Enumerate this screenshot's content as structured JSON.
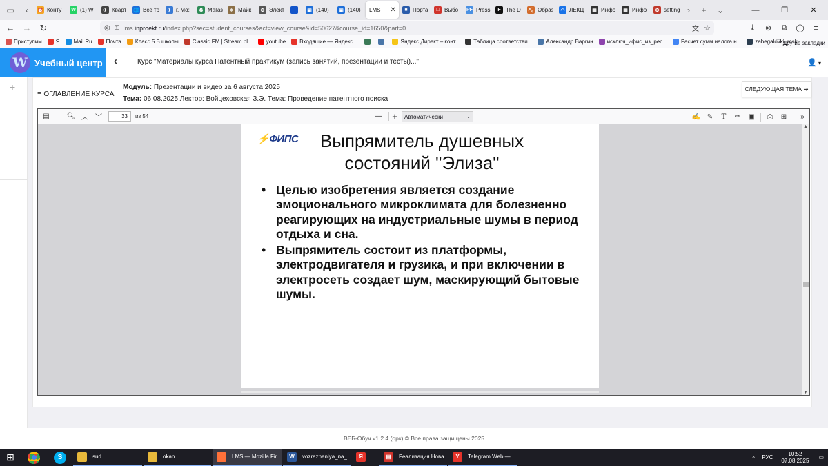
{
  "browser": {
    "tabs": [
      {
        "label": "Конту",
        "color": "#f5a623",
        "glyph": "⏰"
      },
      {
        "label": "(1) W",
        "color": "#25d366",
        "glyph": "W"
      },
      {
        "label": "Кварт",
        "color": "#444",
        "glyph": "✈"
      },
      {
        "label": "Все то",
        "color": "#1e6fd9",
        "glyph": "🌐"
      },
      {
        "label": "г. Мо:",
        "color": "#3a7bd5",
        "glyph": "✈"
      },
      {
        "label": "Магаз",
        "color": "#2e8b57",
        "glyph": "♻"
      },
      {
        "label": "Майк",
        "color": "#8b6f47",
        "glyph": "✳"
      },
      {
        "label": "Элект",
        "color": "#555",
        "glyph": "⚙"
      },
      {
        "label": "",
        "color": "#1355c9",
        "glyph": ""
      },
      {
        "label": "(140)",
        "color": "#1e6fd9",
        "glyph": "▣"
      },
      {
        "label": "(140)",
        "color": "#1e6fd9",
        "glyph": "▣"
      },
      {
        "label": "LMS",
        "color": "",
        "glyph": "",
        "active": true
      },
      {
        "label": "Порта",
        "color": "#2a5caa",
        "glyph": "■"
      },
      {
        "label": "Выбо",
        "color": "#d0342c",
        "glyph": "□"
      },
      {
        "label": "Pressl",
        "color": "#4a90e2",
        "glyph": "PF"
      },
      {
        "label": "The D",
        "color": "#111",
        "glyph": "F"
      },
      {
        "label": "Образ",
        "color": "#d26b2b",
        "glyph": "⛏"
      },
      {
        "label": "ЛЕКЦ",
        "color": "#1a73e8",
        "glyph": "◠"
      },
      {
        "label": "Инфо",
        "color": "#333",
        "glyph": "▦"
      },
      {
        "label": "Инфо",
        "color": "#333",
        "glyph": "▦"
      },
      {
        "label": "setting",
        "color": "#c0392b",
        "glyph": "⚙"
      }
    ],
    "url_prefix": "lms.",
    "url_domain": "inproekt.ru",
    "url_path": "/index.php?sec=student_courses&act=view_course&id=50627&course_id=1650&part=0",
    "bookmarks": [
      {
        "label": "Приступим",
        "color": "#d9534f"
      },
      {
        "label": "Я",
        "color": "#e6332a"
      },
      {
        "label": "Mail.Ru",
        "color": "#168de2"
      },
      {
        "label": "Почта",
        "color": "#e6332a"
      },
      {
        "label": "Класс 5 Б школы",
        "color": "#f39c12"
      },
      {
        "label": "Classic FM | Stream pl...",
        "color": "#c0392b"
      },
      {
        "label": "youtube",
        "color": "#ff0000"
      },
      {
        "label": "Входящие — Яндекс....",
        "color": "#e6332a"
      },
      {
        "label": "",
        "color": "#3b7a57"
      },
      {
        "label": "",
        "color": "#4a76a8"
      },
      {
        "label": "Яндекс.Директ – конт...",
        "color": "#f5c518"
      },
      {
        "label": "Таблица соответстви...",
        "color": "#333"
      },
      {
        "label": "Александр Варгин",
        "color": "#4a76a8"
      },
      {
        "label": "исключ_ифис_из_рес...",
        "color": "#8e44ad"
      },
      {
        "label": "Расчет сумм налога н...",
        "color": "#4285f4"
      },
      {
        "label": "zabegalovki_msk",
        "color": "#2c3e50"
      }
    ],
    "other_bookmarks": "Другие закладки"
  },
  "site": {
    "brand": "Учебный центр",
    "course_title": "Курс \"Материалы курса Патентный практикум (запись занятий, презентации и тесты)...\"",
    "toc_label": "ОГЛАВЛЕНИЕ КУРСА",
    "module_label": "Модуль:",
    "module_value": "Презентации и видео за 6 августа 2025",
    "topic_label": "Тема:",
    "topic_value": "06.08.2025 Лектор: Войцеховская З.Э. Тема: Проведение патентного поиска",
    "next_button": "СЛЕДУЮЩАЯ ТЕМА ➔",
    "footer": "ВЕБ-Обуч v1.2.4 (орк) © Все права защищены 2025"
  },
  "pdf": {
    "page_number": "33",
    "page_total": "из 54",
    "zoom": "Автоматически"
  },
  "slide": {
    "logo": "ФИПС",
    "title": "Выпрямитель душевных состояний \"Элиза\"",
    "bullets": [
      "Целью изобретения является создание эмоционального микроклимата для болезненно реагирующих на индустриальные шумы в период отдыха и сна.",
      "Выпрямитель состоит из платформы, электродвигателя и грузика, и при включении в электросеть создает шум, маскирующий бытовые шумы."
    ]
  },
  "taskbar": {
    "apps": [
      {
        "label": "sud",
        "color": "#e8b93b",
        "glyph": "",
        "open": true,
        "width": 100
      },
      {
        "label": "okan",
        "color": "#e8b93b",
        "glyph": "",
        "open": true,
        "width": 98
      },
      {
        "label": "LMS — Mozilla Fir...",
        "color": "#ff7139",
        "glyph": "",
        "open": true,
        "width": 100,
        "active": true
      },
      {
        "label": "vozrazheniya_na_...",
        "color": "#2b579a",
        "glyph": "W",
        "open": true,
        "width": 98
      },
      {
        "label": "",
        "color": "#e6332a",
        "glyph": "Я",
        "open": false,
        "width": 38
      },
      {
        "label": "Реализация Нова...",
        "color": "#d0342c",
        "glyph": "▤",
        "open": true,
        "width": 98
      },
      {
        "label": "Telegram Web — ...",
        "color": "#e6332a",
        "glyph": "Y",
        "open": true,
        "width": 100
      }
    ],
    "lang": "РУС",
    "time": "10:52",
    "date": "07.08.2025"
  }
}
